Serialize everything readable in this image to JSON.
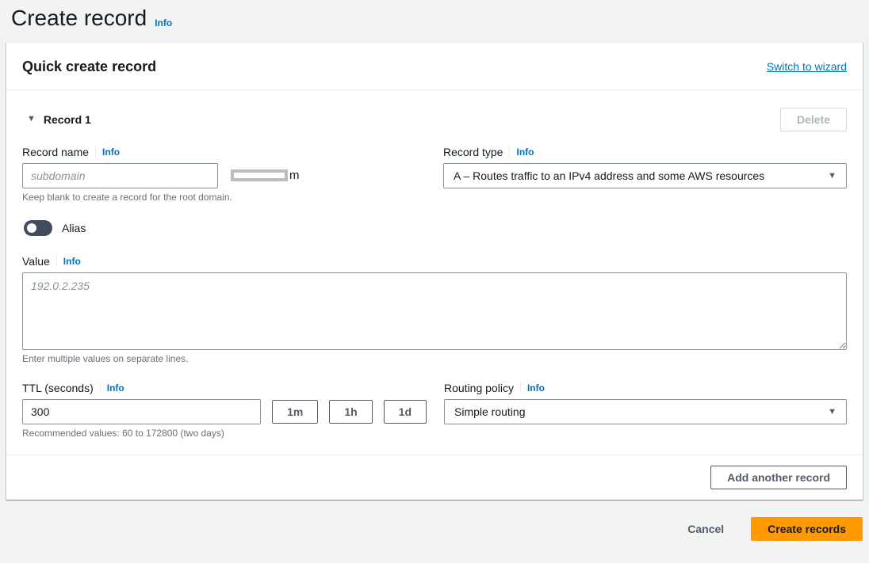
{
  "page": {
    "title": "Create record",
    "title_info": "Info"
  },
  "panel": {
    "header": "Quick create record",
    "switch_link": "Switch to wizard",
    "record": {
      "title": "Record 1",
      "delete_label": "Delete",
      "fields": {
        "record_name": {
          "label": "Record name",
          "info": "Info",
          "placeholder": "subdomain",
          "domain_suffix": "m",
          "helper": "Keep blank to create a record for the root domain."
        },
        "record_type": {
          "label": "Record type",
          "info": "Info",
          "value": "A – Routes traffic to an IPv4 address and some AWS resources"
        },
        "alias": {
          "label": "Alias",
          "state": "off"
        },
        "value": {
          "label": "Value",
          "info": "Info",
          "placeholder": "192.0.2.235",
          "helper": "Enter multiple values on separate lines."
        },
        "ttl": {
          "label": "TTL (seconds)",
          "info": "Info",
          "value": "300",
          "quick_buttons": [
            "1m",
            "1h",
            "1d"
          ],
          "helper": "Recommended values: 60 to 172800 (two days)"
        },
        "routing_policy": {
          "label": "Routing policy",
          "info": "Info",
          "value": "Simple routing"
        }
      }
    },
    "add_button": "Add another record"
  },
  "footer": {
    "cancel": "Cancel",
    "create": "Create records"
  },
  "icons": {
    "collapse": "▼",
    "dropdown": "▼"
  },
  "colors": {
    "link_blue": "#0073bb",
    "primary_orange": "#ff9900",
    "button_border": "#545b64",
    "helper_gray": "#687078",
    "toggle_off": "#414d5c"
  }
}
